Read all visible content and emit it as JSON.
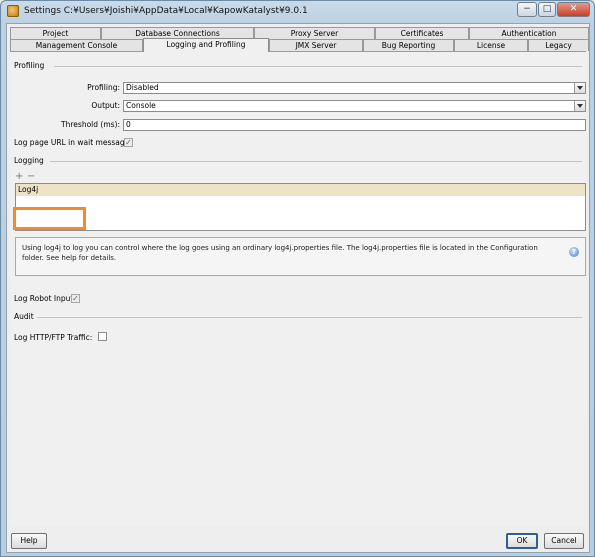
{
  "window": {
    "title": "Settings   C:¥Users¥Joishi¥AppData¥Local¥KapowKatalyst¥9.0.1"
  },
  "window_buttons": {
    "minimize": "−",
    "maximize": "□",
    "close": "✕"
  },
  "tabs_row1": [
    {
      "label": "Project"
    },
    {
      "label": "Database Connections"
    },
    {
      "label": "Proxy Server"
    },
    {
      "label": "Certificates"
    },
    {
      "label": "Authentication"
    }
  ],
  "tabs_row2": [
    {
      "label": "Management Console"
    },
    {
      "label": "Logging and Profiling",
      "active": true
    },
    {
      "label": "JMX Server"
    },
    {
      "label": "Bug Reporting"
    },
    {
      "label": "License"
    },
    {
      "label": "Legacy"
    }
  ],
  "profiling": {
    "section_title": "Profiling",
    "profiling_label": "Profiling:",
    "profiling_value": "Disabled",
    "output_label": "Output:",
    "output_value": "Console",
    "threshold_label": "Threshold (ms):",
    "threshold_value": "0",
    "log_page_url_label": "Log page URL in wait message:",
    "log_page_url_checked": true
  },
  "logging": {
    "section_title": "Logging",
    "add_icon": "add-icon",
    "remove_icon": "remove-icon",
    "items": [
      {
        "label": "Log4j",
        "selected": true
      }
    ],
    "info_text": "Using log4j to log you can control where the log goes using an ordinary log4j.properties file. The log4j.properties file is located in the Configuration folder. See help for details.",
    "info_icon_text": "?",
    "log_robot_input_label": "Log Robot Input:",
    "log_robot_input_checked": true,
    "highlight_color": "#f48b2a"
  },
  "audit": {
    "section_title": "Audit",
    "log_http_label": "Log HTTP/FTP Traffic:",
    "log_http_checked": false
  },
  "footer": {
    "help_label": "Help",
    "ok_label": "OK",
    "cancel_label": "Cancel"
  }
}
